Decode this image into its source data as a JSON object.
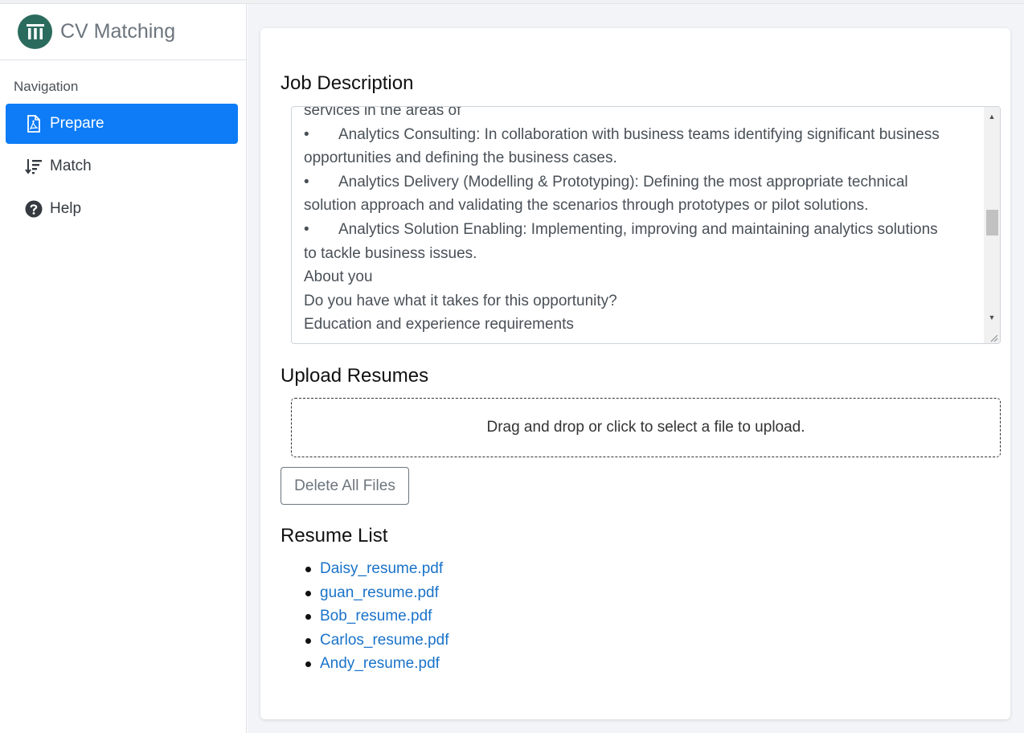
{
  "brand": {
    "title": "CV Matching",
    "logo_color": "#2b6b5e"
  },
  "sidebar": {
    "heading": "Navigation",
    "items": [
      {
        "label": "Prepare",
        "icon": "pdf-file-icon",
        "active": true
      },
      {
        "label": "Match",
        "icon": "sort-descending-icon",
        "active": false
      },
      {
        "label": "Help",
        "icon": "question-circle-icon",
        "active": false
      }
    ]
  },
  "main": {
    "job_description": {
      "title": "Job Description",
      "lines": [
        {
          "bullet": "",
          "text": "services in the areas of"
        },
        {
          "bullet": "•",
          "text": "Analytics Consulting: In collaboration with business teams identifying significant business"
        },
        {
          "bullet": "",
          "text": "opportunities and defining the business cases."
        },
        {
          "bullet": "•",
          "text": "Analytics Delivery (Modelling & Prototyping): Defining the most appropriate technical"
        },
        {
          "bullet": "",
          "text": "solution approach and validating the scenarios through prototypes or pilot solutions."
        },
        {
          "bullet": "•",
          "text": "Analytics Solution Enabling: Implementing, improving and maintaining analytics solutions"
        },
        {
          "bullet": "",
          "text": "to tackle business issues."
        },
        {
          "bullet": "",
          "text": "About you"
        },
        {
          "bullet": "",
          "text": "Do you have what it takes for this opportunity?"
        },
        {
          "bullet": "",
          "text": "Education and experience requirements"
        }
      ]
    },
    "upload": {
      "title": "Upload Resumes",
      "dropzone_text": "Drag and drop or click to select a file to upload.",
      "delete_label": "Delete All Files"
    },
    "resume_list": {
      "title": "Resume List",
      "items": [
        "Daisy_resume.pdf",
        "guan_resume.pdf",
        "Bob_resume.pdf",
        "Carlos_resume.pdf",
        "Andy_resume.pdf"
      ]
    }
  },
  "colors": {
    "accent": "#0d7cf6",
    "link": "#1a73c9"
  }
}
